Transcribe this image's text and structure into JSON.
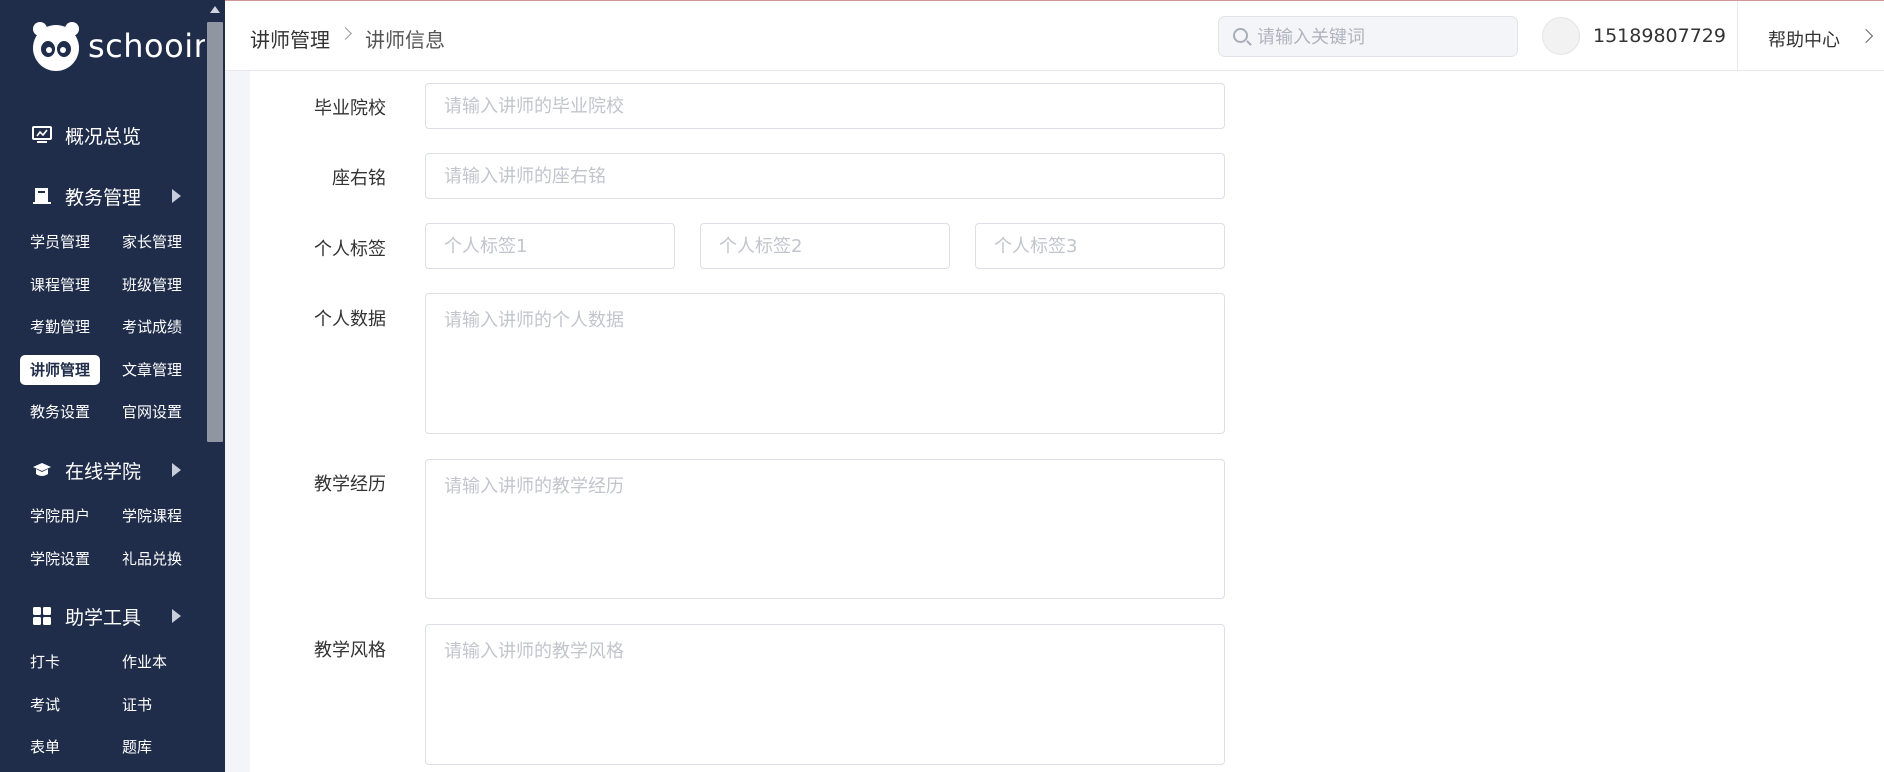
{
  "brand": {
    "name": "schooin"
  },
  "sidebar": {
    "groups": [
      {
        "label": "概况总览",
        "icon": "monitor-icon"
      },
      {
        "label": "教务管理",
        "icon": "book-icon"
      },
      {
        "label": "在线学院",
        "icon": "graduation-cap-icon"
      },
      {
        "label": "助学工具",
        "icon": "grid-icon"
      }
    ],
    "academic": [
      "学员管理",
      "家长管理",
      "课程管理",
      "班级管理",
      "考勤管理",
      "考试成绩",
      "讲师管理",
      "文章管理",
      "教务设置",
      "官网设置"
    ],
    "college": [
      "学院用户",
      "学院课程",
      "学院设置",
      "礼品兑换"
    ],
    "tools": [
      "打卡",
      "作业本",
      "考试",
      "证书",
      "表单",
      "题库"
    ],
    "active_item": "讲师管理"
  },
  "header": {
    "breadcrumb": [
      "讲师管理",
      "讲师信息"
    ],
    "search_placeholder": "请输入关键词",
    "phone": "15189807729",
    "help": "帮助中心"
  },
  "form": {
    "school": {
      "label": "毕业院校",
      "placeholder": "请输入讲师的毕业院校"
    },
    "motto": {
      "label": "座右铭",
      "placeholder": "请输入讲师的座右铭"
    },
    "tags": {
      "label": "个人标签",
      "placeholders": [
        "个人标签1",
        "个人标签2",
        "个人标签3"
      ]
    },
    "data": {
      "label": "个人数据",
      "placeholder": "请输入讲师的个人数据"
    },
    "experience": {
      "label": "教学经历",
      "placeholder": "请输入讲师的教学经历"
    },
    "style": {
      "label": "教学风格",
      "placeholder": "请输入讲师的教学风格"
    }
  },
  "colors": {
    "sidebar_bg": "#1f2d4a",
    "page_bg": "#f3f5f9"
  }
}
